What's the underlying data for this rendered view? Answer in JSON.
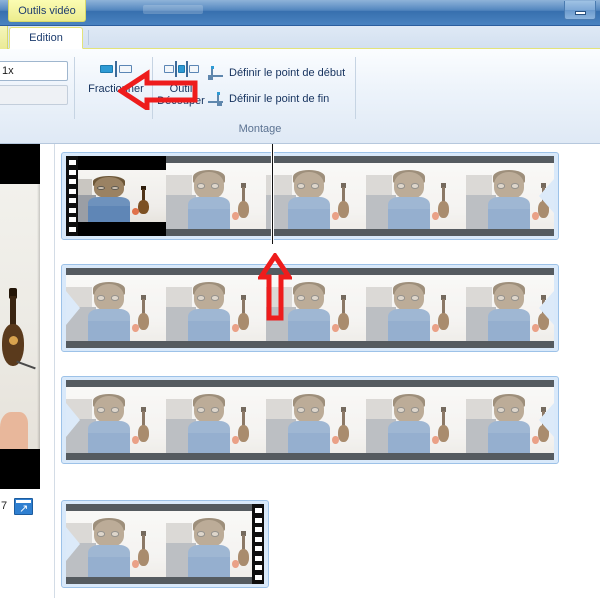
{
  "window": {
    "contextual_tab_label": "Outils vidéo",
    "minimize_label": "Réduire"
  },
  "tabs": [
    {
      "label": "Edition",
      "active": true
    }
  ],
  "ribbon": {
    "zoom_combo": {
      "value": "1x",
      "placeholder": "1x"
    },
    "secondary_combo": {
      "value": "",
      "placeholder": ""
    },
    "buttons": [
      {
        "id": "split",
        "label": "Fractionner",
        "icon": "split-icon"
      },
      {
        "id": "trim",
        "label": "Outil\nDécouper",
        "icon": "trim-tool-icon"
      }
    ],
    "small_buttons": [
      {
        "id": "set-start",
        "label": "Définir le point de début",
        "icon": "set-start-point-icon"
      },
      {
        "id": "set-end",
        "label": "Définir le point de fin",
        "icon": "set-end-point-icon"
      }
    ],
    "group_label": "Montage"
  },
  "preview": {
    "counter": "7",
    "expand_label": "Plein écran",
    "expand_icon": "expand-window-icon"
  },
  "storyboard": {
    "playhead": {
      "position_label": ""
    },
    "clips": [
      {
        "id": "clip-row-1",
        "selected": true,
        "thumbs": 5,
        "leader_left": true,
        "leader_right": false,
        "continues_left": false,
        "continues_right": true,
        "letterboxed_first_frame": true
      },
      {
        "id": "clip-row-2",
        "selected": true,
        "thumbs": 5,
        "leader_left": false,
        "leader_right": false,
        "continues_left": true,
        "continues_right": true,
        "letterboxed_first_frame": false
      },
      {
        "id": "clip-row-3",
        "selected": true,
        "thumbs": 5,
        "leader_left": false,
        "leader_right": false,
        "continues_left": true,
        "continues_right": true,
        "letterboxed_first_frame": false
      },
      {
        "id": "clip-row-4",
        "selected": true,
        "thumbs": 2,
        "leader_left": false,
        "leader_right": true,
        "continues_left": true,
        "continues_right": false,
        "letterboxed_first_frame": false
      }
    ]
  },
  "annotations": [
    {
      "id": "arrow-to-split-button",
      "shape": "left-arrow",
      "color": "#ee1c1c"
    },
    {
      "id": "arrow-to-playhead",
      "shape": "up-arrow",
      "color": "#ee1c1c"
    }
  ],
  "colors": {
    "accent": "#2f7fd0",
    "titlebar": "#4a80bb",
    "contextual": "#ecec8d",
    "clip_selected": "#d9e9fa",
    "annotation": "#ee1c1c"
  }
}
